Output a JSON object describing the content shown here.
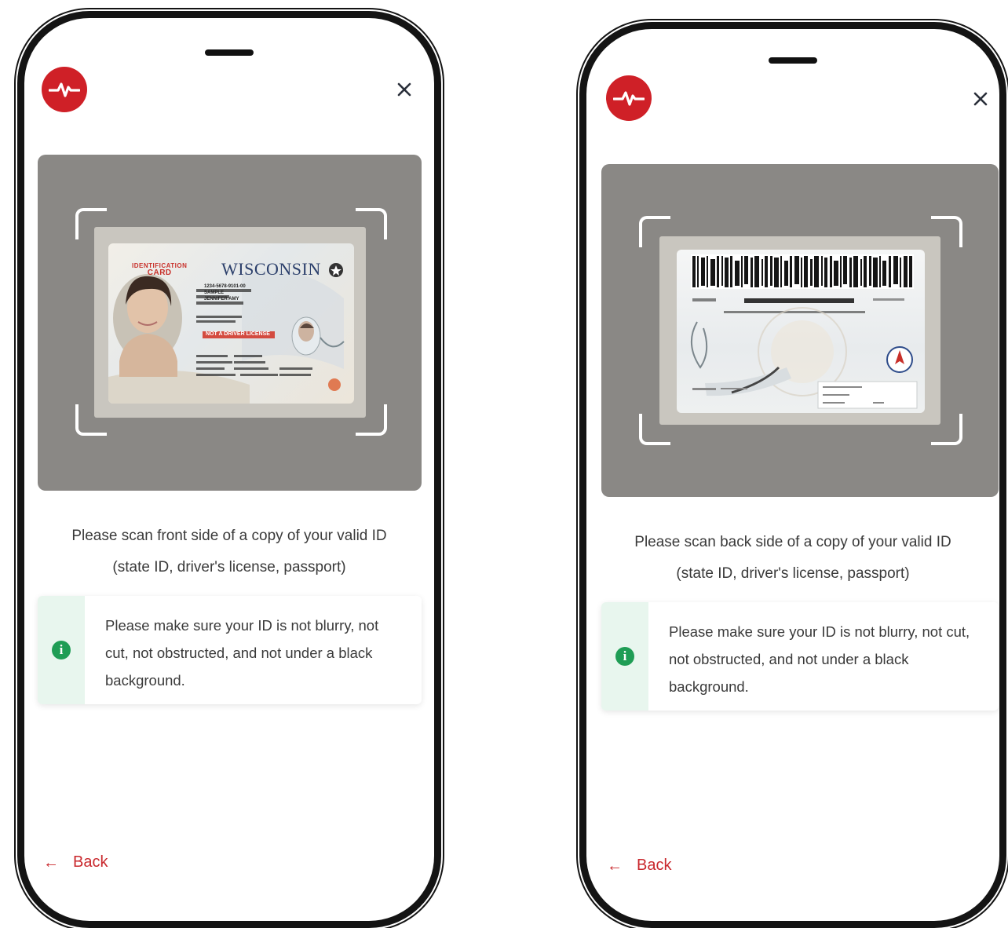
{
  "screens": [
    {
      "id": "front",
      "instruction_line1": "Please scan front side of a copy of your valid ID",
      "instruction_line2": "(state ID, driver's license, passport)",
      "notice_text": "Please make sure your ID is not blurry, not cut, not obstructed, and not under a black background.",
      "back_label": "Back",
      "close_label": "×",
      "card": {
        "header_label_1": "IDENTIFICATION",
        "header_label_2": "CARD",
        "state_name": "WISCONSIN",
        "id_number": "1234-5678-9101-00",
        "name_line_1": "SAMPLE",
        "name_line_2": "JENNIFER AMY",
        "warning": "NOT A DRIVER LICENSE"
      }
    },
    {
      "id": "back",
      "instruction_line1": "Please scan back side of a copy of your valid ID",
      "instruction_line2": "(state ID, driver's license, passport)",
      "notice_text": "Please make sure your ID is not blurry, not cut, not obstructed, and not under a black background.",
      "back_label": "Back",
      "close_label": "×"
    }
  ],
  "icons": {
    "logo": "heartbeat-logo",
    "close": "close-icon",
    "info": "info-icon",
    "back": "arrow-left-icon"
  },
  "colors": {
    "brand_red": "#cf2027",
    "link_red": "#c9282d",
    "info_green": "#1f9d55",
    "info_strip": "#e8f6ee",
    "scan_bg": "#8a8885"
  }
}
